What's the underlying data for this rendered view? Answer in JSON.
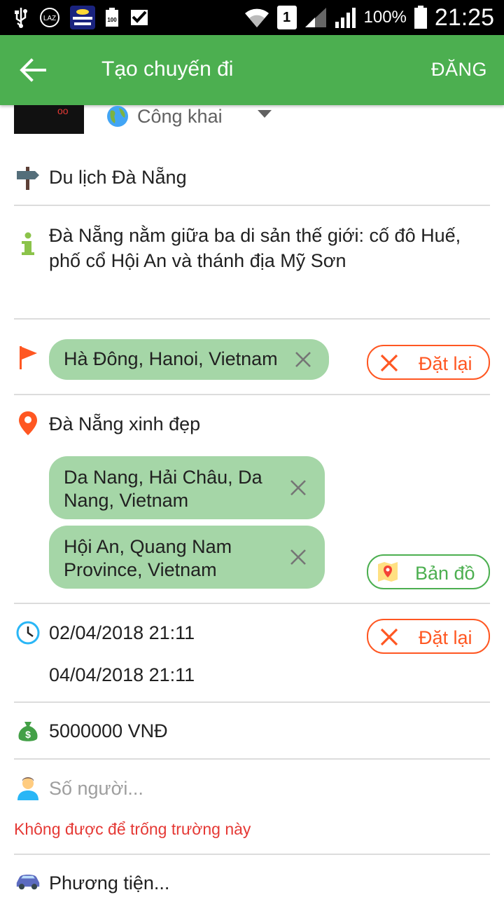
{
  "status_bar": {
    "battery_percent": "100%",
    "time": "21:25",
    "sim_slot": "1",
    "app_badge": "100",
    "left_icons": [
      "usb-icon",
      "laz-icon",
      "toeic-app-icon",
      "app-badge-icon",
      "check-task-icon"
    ],
    "right_icons": [
      "wifi-icon",
      "sim-icon",
      "signal-icon",
      "battery-icon"
    ]
  },
  "app_bar": {
    "title": "Tạo chuyến đi",
    "action": "ĐĂNG",
    "color": "#4caf50"
  },
  "trip": {
    "privacy": "Công khai",
    "name": "Du lịch Đà Nẵng",
    "description": "Đà Nẵng nằm giữa ba di sản thế giới: cố đô Huế, phố cổ Hội An và thánh địa Mỹ Sơn",
    "start_location": "Hà Đông, Hanoi, Vietnam",
    "destination_title": "Đà Nẵng xinh đẹp",
    "destinations": [
      "Da Nang, Hải Châu, Da Nang, Vietnam",
      "Hội An, Quang Nam Province, Vietnam"
    ],
    "start_time": "02/04/2018 21:11",
    "end_time": "04/04/2018 21:11",
    "budget": "5000000 VNĐ",
    "people_placeholder": "Số người...",
    "people_error": "Không được để trống trường này",
    "vehicle_placeholder": "Phương tiện..."
  },
  "buttons": {
    "reset": "Đặt lại",
    "map": "Bản đồ"
  },
  "colors": {
    "accent": "#4caf50",
    "chip": "#a5d6a7",
    "reset": "#ff5722",
    "error": "#e53935"
  }
}
